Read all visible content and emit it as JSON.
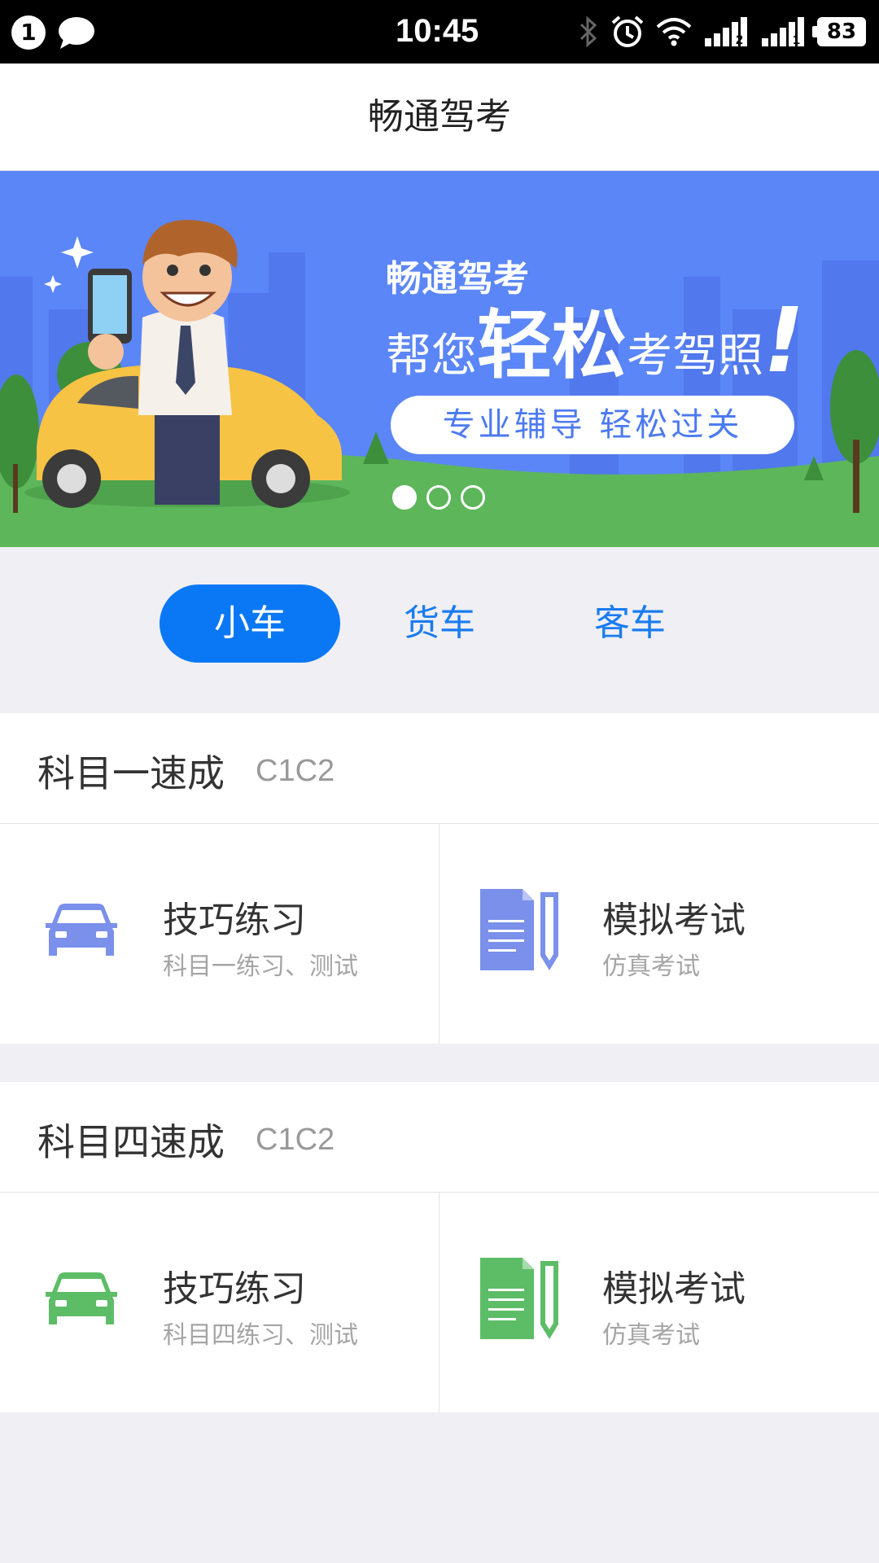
{
  "status_bar": {
    "notification_count": "1",
    "time": "10:45",
    "battery": "83",
    "icons": [
      "chat-bubble-icon",
      "bluetooth-icon",
      "alarm-icon",
      "wifi-icon",
      "signal-2-icon",
      "signal-1-icon",
      "battery-icon"
    ]
  },
  "app": {
    "title": "畅通驾考"
  },
  "banner": {
    "brand": "畅通驾考",
    "slogan_prefix": "帮您",
    "slogan_emphasis": "轻松",
    "slogan_suffix": "考驾照",
    "slogan_bang": "!",
    "pill_text": "专业辅导  轻松过关",
    "slide_count": 3,
    "active_slide": 0,
    "colors": {
      "sky": "#5b86f7",
      "grass": "#5db65a",
      "car": "#f6c344"
    }
  },
  "vehicle_tabs": [
    {
      "label": "小车",
      "active": true
    },
    {
      "label": "货车",
      "active": false
    },
    {
      "label": "客车",
      "active": false
    }
  ],
  "sections": [
    {
      "title": "科目一速成",
      "code": "C1C2",
      "accent": "#7a90ea",
      "cards": [
        {
          "icon": "car-icon",
          "title": "技巧练习",
          "subtitle": "科目一练习、测试"
        },
        {
          "icon": "document-pencil-icon",
          "title": "模拟考试",
          "subtitle": "仿真考试"
        }
      ]
    },
    {
      "title": "科目四速成",
      "code": "C1C2",
      "accent": "#5dbd67",
      "cards": [
        {
          "icon": "car-icon",
          "title": "技巧练习",
          "subtitle": "科目四练习、测试"
        },
        {
          "icon": "document-pencil-icon",
          "title": "模拟考试",
          "subtitle": "仿真考试"
        }
      ]
    }
  ],
  "colors": {
    "tab_active": "#0a78f4",
    "tab_text": "#1a7cf0",
    "background": "#efeff4"
  }
}
